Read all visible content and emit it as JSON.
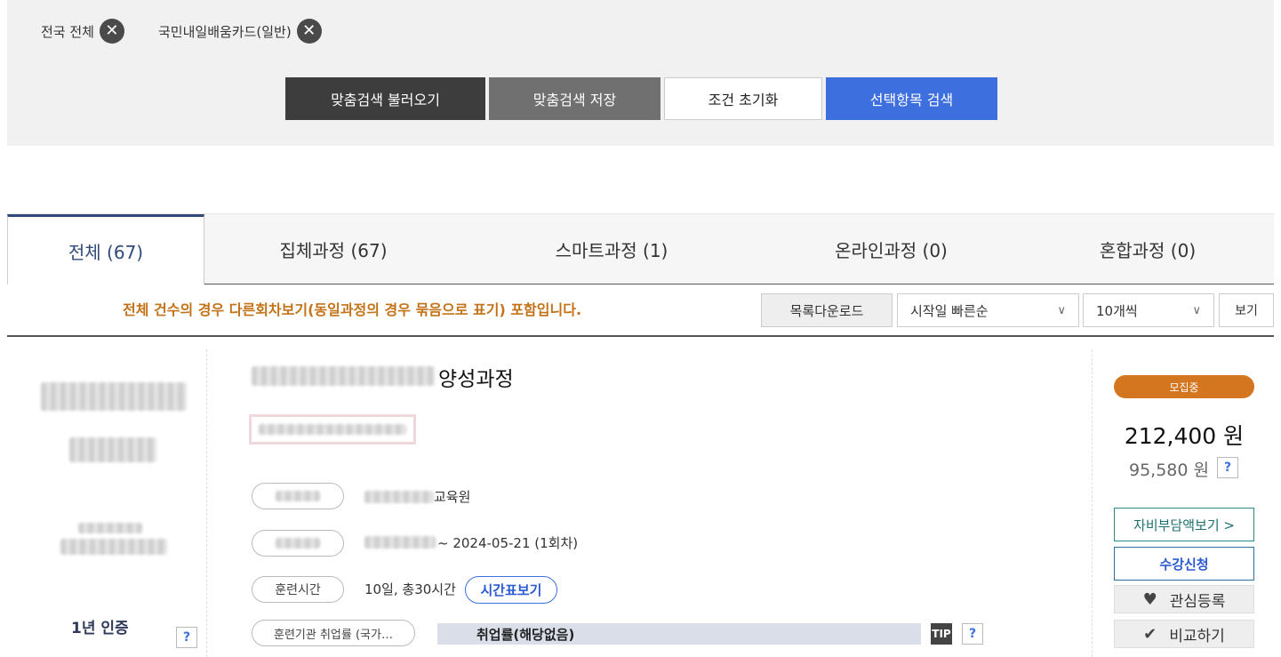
{
  "filters": {
    "chips": [
      {
        "label": "전국 전체"
      },
      {
        "label": "국민내일배움카드(일반)"
      }
    ],
    "remove_glyph": "✕"
  },
  "actions": {
    "load_saved": "맞춤검색 불러오기",
    "save_search": "맞춤검색 저장",
    "reset": "조건 초기화",
    "search_selected": "선택항목 검색"
  },
  "tabs": [
    {
      "label": "전체 (67)",
      "active": true
    },
    {
      "label": "집체과정 (67)",
      "active": false
    },
    {
      "label": "스마트과정 (1)",
      "active": false
    },
    {
      "label": "온라인과정 (0)",
      "active": false
    },
    {
      "label": "혼합과정 (0)",
      "active": false
    }
  ],
  "toolbar": {
    "notice": "전체 건수의 경우 다른회차보기(동일과정의 경우 묶음으로 표기) 포함입니다.",
    "download": "목록다운로드",
    "sort_value": "시작일 빠른순",
    "page_size_value": "10개씩",
    "view": "보기",
    "chevron": "∨"
  },
  "course": {
    "certification": "1년 인증",
    "help": "?",
    "title_suffix": "양성과정",
    "institution_suffix": "교육원",
    "period_suffix": "~ 2024-05-21 (1회차)",
    "hours_label": "훈련시간",
    "hours_value": "10일, 총30시간",
    "schedule_button": "시간표보기",
    "employment_label": "훈련기관 취업률 (국가…",
    "employment_value": "취업률(해당없음)",
    "tip": "TIP",
    "status": "모집중",
    "price_total": "212,400 원",
    "price_self": "95,580 원",
    "self_pay_button": "자비부담액보기 >",
    "enroll_button": "수강신청",
    "wish_button": "관심등록",
    "compare_button": "비교하기",
    "icons": {
      "heart": "♥",
      "check": "✔"
    }
  }
}
